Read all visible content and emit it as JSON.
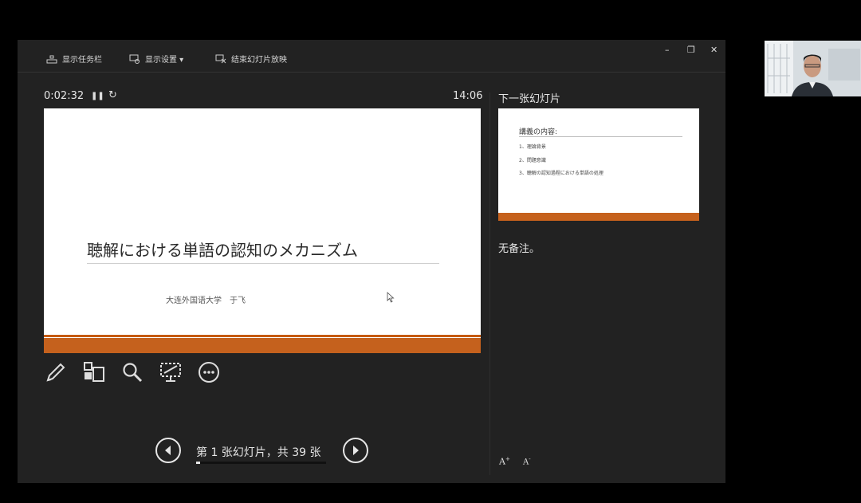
{
  "toolbar": {
    "taskbar_label": "显示任务栏",
    "display_settings_label": "显示设置 ▾",
    "end_show_label": "结束幻灯片放映"
  },
  "window_controls": {
    "minimize": "–",
    "restore": "❐",
    "close": "✕"
  },
  "presenter": {
    "elapsed": "0:02:32",
    "clock": "14:06",
    "next_slide_heading": "下一张幻灯片",
    "notes_text": "无备注。"
  },
  "current_slide": {
    "title": "聴解における単語の認知のメカニズム",
    "subtitle": "大连外国语大学　于飞",
    "accent_color": "#c5611d"
  },
  "next_slide": {
    "title": "講義の内容:",
    "items": [
      "1、理論背景",
      "2、問題意識",
      "3、聴解の認知過程における単語の処理"
    ]
  },
  "tools": [
    "pen-icon",
    "slides-grid-icon",
    "zoom-icon",
    "screen-icon",
    "more-icon"
  ],
  "navigation": {
    "counter": "第 1 张幻灯片，共 39 张",
    "current": 1,
    "total": 39,
    "progress_fraction": 0.026
  },
  "font_buttons": {
    "increase": "A",
    "decrease": "A"
  }
}
